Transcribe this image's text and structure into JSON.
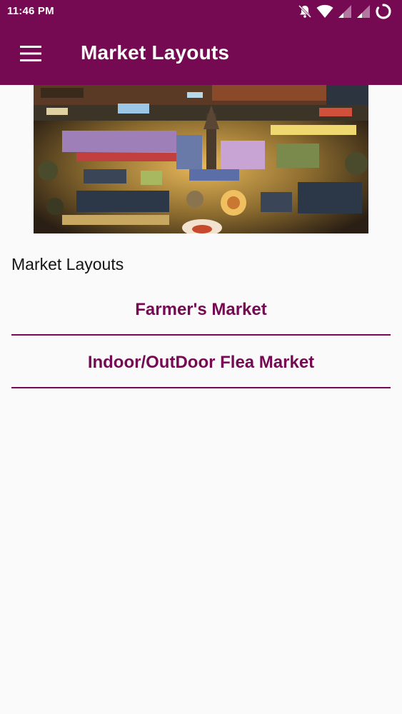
{
  "status_bar": {
    "time": "11:46 PM",
    "icons": [
      "notifications-off-icon",
      "wifi-icon",
      "signal-icon",
      "signal-icon",
      "battery-charging-icon"
    ]
  },
  "app_bar": {
    "title": "Market Layouts",
    "menu_icon": "hamburger-menu-icon"
  },
  "banner": {
    "image": "aerial view of a night market"
  },
  "main": {
    "heading": "Market Layouts",
    "links": [
      {
        "label": "Farmer's Market"
      },
      {
        "label": "Indoor/OutDoor Flea Market"
      }
    ]
  },
  "colors": {
    "primary": "#750a52",
    "background": "#fafafa",
    "text": "#141414"
  }
}
